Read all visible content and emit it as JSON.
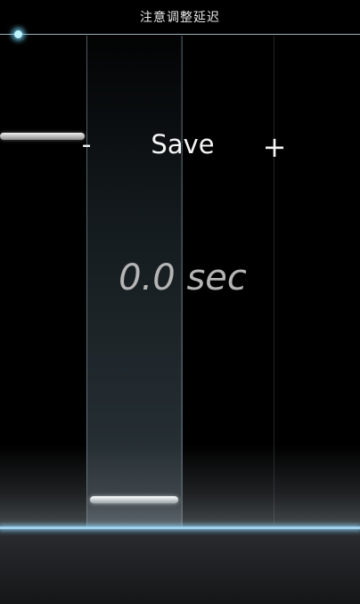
{
  "header": {
    "title": "注意调整延迟"
  },
  "progress": {
    "value": 0.05
  },
  "controls": {
    "minus_label": "-",
    "save_label": "Save",
    "plus_label": "+"
  },
  "delay": {
    "value_text": "0.0 sec"
  },
  "colors": {
    "accent": "#9fd2ee",
    "background": "#000000"
  }
}
